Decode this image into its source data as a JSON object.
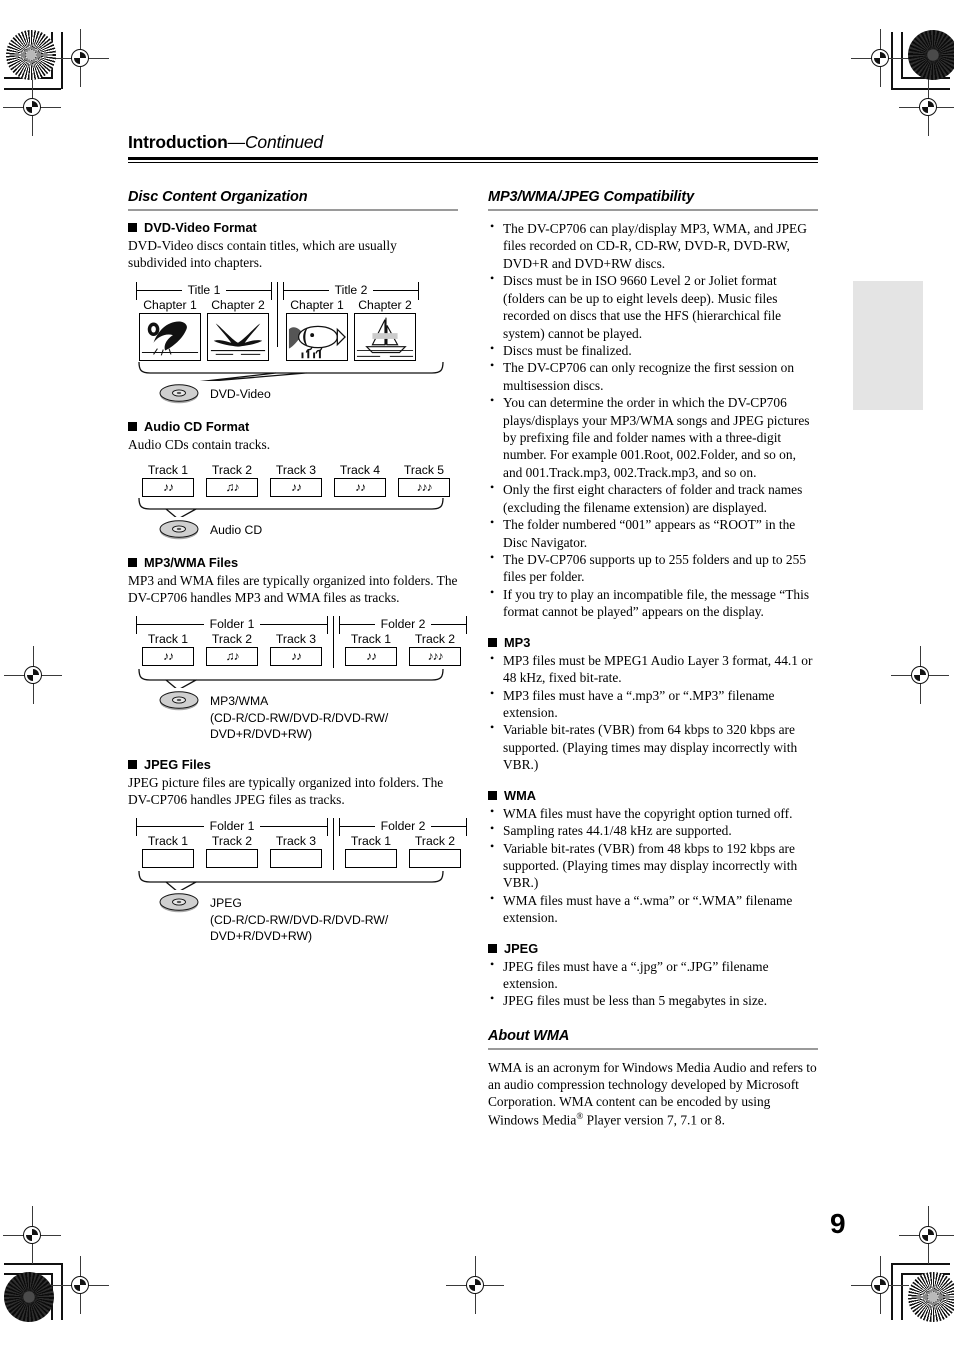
{
  "page": {
    "number": "9",
    "running_head_main": "Introduction",
    "running_head_cont": "—Continued"
  },
  "left_column": {
    "section_title": "Disc Content Organization",
    "subsections": [
      {
        "heading": "DVD-Video Format",
        "body": "DVD-Video discs contain titles, which are usually subdivided into chapters.",
        "diagram": {
          "groups": [
            {
              "label": "Title 1",
              "items": [
                {
                  "caption": "Chapter 1"
                },
                {
                  "caption": "Chapter 2"
                }
              ]
            },
            {
              "label": "Title 2",
              "items": [
                {
                  "caption": "Chapter 1"
                },
                {
                  "caption": "Chapter 2"
                }
              ]
            }
          ],
          "disc_label": "DVD-Video"
        }
      },
      {
        "heading": "Audio CD Format",
        "body": "Audio CDs contain tracks.",
        "diagram": {
          "items": [
            {
              "caption": "Track 1",
              "glyph": "♪♪"
            },
            {
              "caption": "Track 2",
              "glyph": "♫♪"
            },
            {
              "caption": "Track 3",
              "glyph": "♪♪"
            },
            {
              "caption": "Track 4",
              "glyph": "♪♪"
            },
            {
              "caption": "Track 5",
              "glyph": "♪♪♪"
            }
          ],
          "disc_label": "Audio CD"
        }
      },
      {
        "heading": "MP3/WMA Files",
        "body": "MP3 and WMA files are typically organized into folders. The DV-CP706 handles MP3 and WMA files as tracks.",
        "diagram": {
          "groups": [
            {
              "label": "Folder 1",
              "items": [
                {
                  "caption": "Track 1",
                  "glyph": "♪♪"
                },
                {
                  "caption": "Track 2",
                  "glyph": "♫♪"
                },
                {
                  "caption": "Track 3",
                  "glyph": "♪♪"
                }
              ]
            },
            {
              "label": "Folder 2",
              "items": [
                {
                  "caption": "Track 1",
                  "glyph": "♪♪"
                },
                {
                  "caption": "Track 2",
                  "glyph": "♪♪♪"
                }
              ]
            }
          ],
          "disc_label": "MP3/WMA\n(CD-R/CD-RW/DVD-R/DVD-RW/\nDVD+R/DVD+RW)"
        }
      },
      {
        "heading": "JPEG Files",
        "body": "JPEG picture files are typically organized into folders. The DV-CP706 handles JPEG files as tracks.",
        "diagram": {
          "groups": [
            {
              "label": "Folder 1",
              "items": [
                {
                  "caption": "Track 1",
                  "glyph": ""
                },
                {
                  "caption": "Track 2",
                  "glyph": ""
                },
                {
                  "caption": "Track 3",
                  "glyph": ""
                }
              ]
            },
            {
              "label": "Folder 2",
              "items": [
                {
                  "caption": "Track 1",
                  "glyph": ""
                },
                {
                  "caption": "Track 2",
                  "glyph": ""
                }
              ]
            }
          ],
          "disc_label": "JPEG\n(CD-R/CD-RW/DVD-R/DVD-RW/\nDVD+R/DVD+RW)"
        }
      }
    ]
  },
  "right_column": {
    "section_title": "MP3/WMA/JPEG Compatibility",
    "bullets": [
      "The DV-CP706 can play/display MP3, WMA, and JPEG files recorded on CD-R, CD-RW, DVD-R, DVD-RW, DVD+R and DVD+RW discs.",
      "Discs must be in ISO 9660 Level 2 or Joliet format (folders can be up to eight levels deep). Music files recorded on discs that use the HFS (hierarchical file system) cannot be played.",
      "Discs must be finalized.",
      "The DV-CP706 can only recognize the first session on multisession discs.",
      "You can determine the order in which the DV-CP706 plays/displays your MP3/WMA songs and JPEG pictures by prefixing file and folder names with a three-digit number. For example 001.Root, 002.Folder, and so on, and 001.Track.mp3, 002.Track.mp3, and so on.",
      "Only the first eight characters of folder and track names (excluding the filename extension) are displayed.",
      "The folder numbered “001” appears as “ROOT” in the Disc Navigator.",
      "The DV-CP706 supports up to 255 folders and up to 255 files per folder.",
      "If you try to play an incompatible file, the message “This format cannot be played” appears on the display."
    ],
    "subsections": [
      {
        "heading": "MP3",
        "bullets": [
          "MP3 files must be MPEG1 Audio Layer 3 format, 44.1 or 48 kHz, fixed bit-rate.",
          "MP3 files must have a “.mp3” or “.MP3” filename extension.",
          "Variable bit-rates (VBR) from 64 kbps to 320 kbps are supported. (Playing times may display incorrectly with VBR.)"
        ]
      },
      {
        "heading": "WMA",
        "bullets": [
          "WMA files must have the copyright option turned off.",
          "Sampling rates 44.1/48 kHz are supported.",
          "Variable bit-rates (VBR) from 48 kbps to 192 kbps are supported. (Playing times may display incorrectly with VBR.)",
          "WMA files must have a “.wma” or “.WMA” filename extension."
        ]
      },
      {
        "heading": "JPEG",
        "bullets": [
          "JPEG files must have a “.jpg” or “.JPG” filename extension.",
          "JPEG files must be less than 5 megabytes in size."
        ]
      }
    ],
    "about_wma": {
      "section_title": "About WMA",
      "text_part1": "WMA is an acronym for Windows Media Audio and refers to an audio compression technology developed by Microsoft Corporation. WMA content can be encoded by using Windows Media",
      "registered_symbol": "®",
      "text_part2": " Player version 7, 7.1 or 8."
    }
  },
  "colors": {
    "rule_gray": "#9a9a9a",
    "disc_gray": "#c9c9c9",
    "side_tab_gray": "#e4e4e4"
  }
}
